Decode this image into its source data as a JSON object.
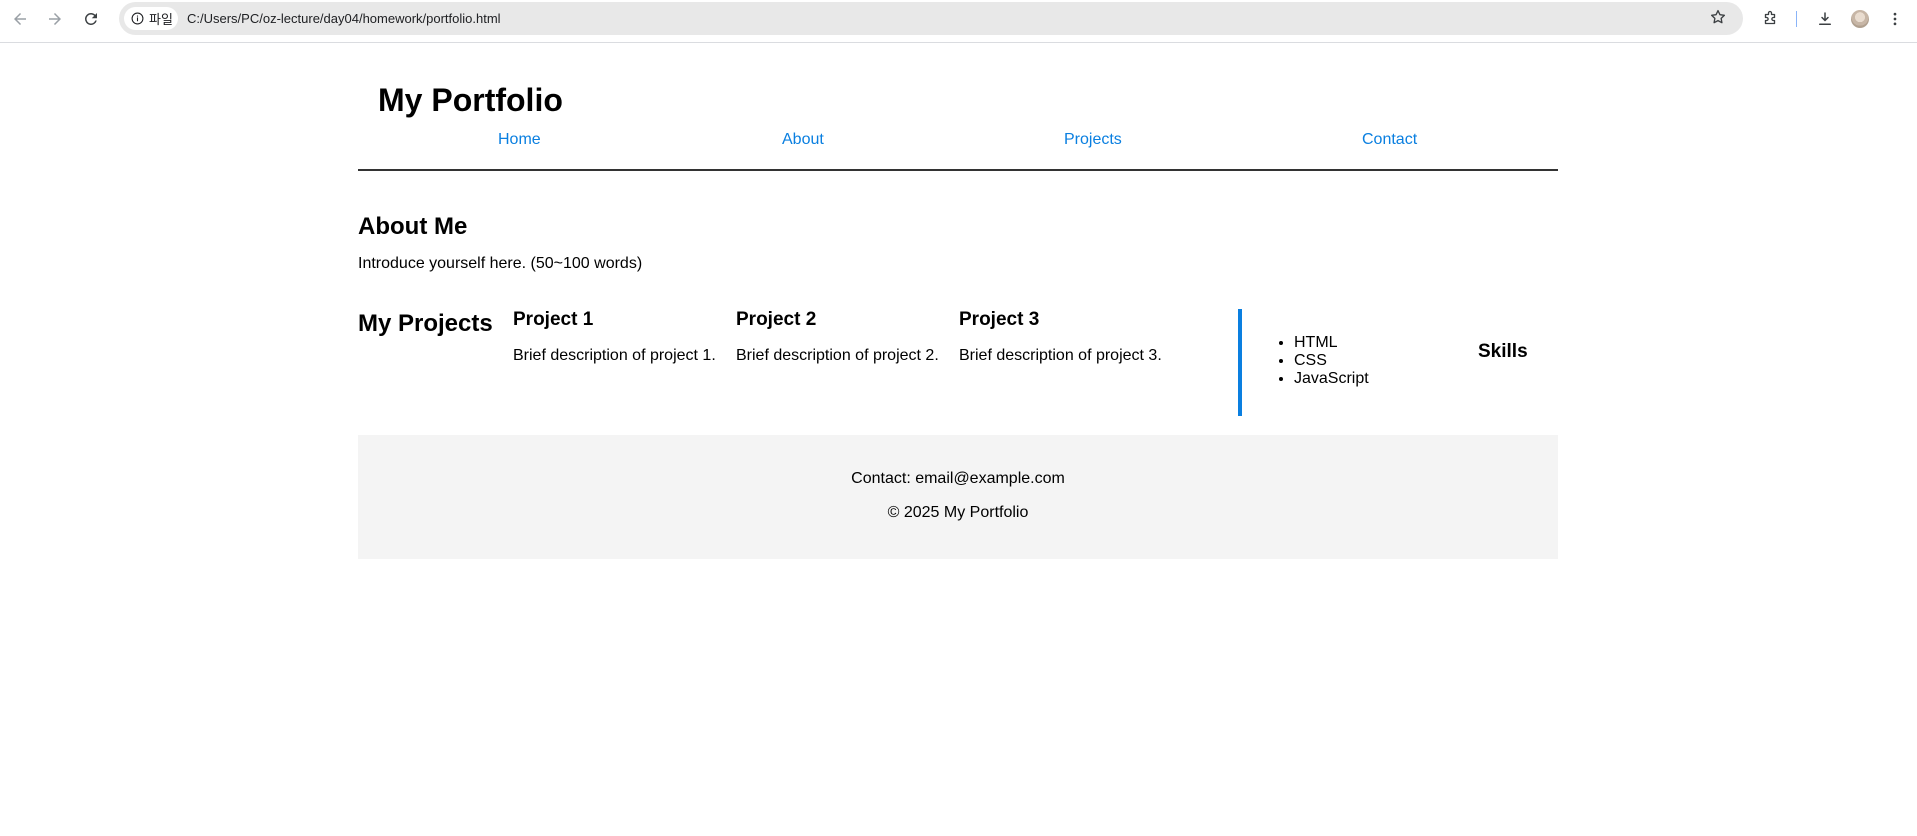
{
  "browser": {
    "back_icon": "arrow-left-icon",
    "forward_icon": "arrow-right-icon",
    "reload_icon": "reload-icon",
    "site_chip_label": "파일",
    "url": "C:/Users/PC/oz-lecture/day04/homework/portfolio.html",
    "toolbar_icons": [
      "star-icon",
      "extensions-icon",
      "download-icon",
      "profile-avatar",
      "more-vert-icon"
    ]
  },
  "header": {
    "title": "My Portfolio",
    "nav": [
      "Home",
      "About",
      "Projects",
      "Contact"
    ]
  },
  "about": {
    "title": "About Me",
    "text": "Introduce yourself here. (50~100 words)"
  },
  "projects": {
    "title": "My Projects",
    "items": [
      {
        "title": "Project 1",
        "description": "Brief description of project 1."
      },
      {
        "title": "Project 2",
        "description": "Brief description of project 2."
      },
      {
        "title": "Project 3",
        "description": "Brief description of project 3."
      }
    ]
  },
  "skills": {
    "title": "Skills",
    "items": [
      "HTML",
      "CSS",
      "JavaScript"
    ]
  },
  "footer": {
    "contact": "Contact: email@example.com",
    "copyright": "© 2025 My Portfolio"
  },
  "colors": {
    "link": "#0a7fe0",
    "accent_border": "#0a7fe0",
    "footer_bg": "#f4f4f4",
    "header_rule": "#333333"
  }
}
